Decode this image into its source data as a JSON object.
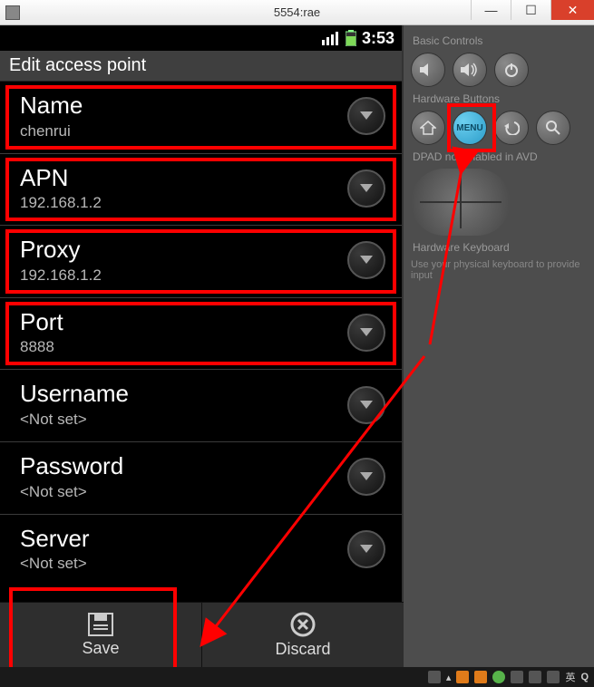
{
  "window": {
    "title": "5554:rae"
  },
  "statusbar": {
    "time": "3:53"
  },
  "screen": {
    "header": "Edit access point",
    "items": [
      {
        "title": "Name",
        "value": "chenrui",
        "highlighted": true
      },
      {
        "title": "APN",
        "value": "192.168.1.2",
        "highlighted": true
      },
      {
        "title": "Proxy",
        "value": "192.168.1.2",
        "highlighted": true
      },
      {
        "title": "Port",
        "value": "8888",
        "highlighted": true
      },
      {
        "title": "Username",
        "value": "<Not set>",
        "highlighted": false
      },
      {
        "title": "Password",
        "value": "<Not set>",
        "highlighted": false
      },
      {
        "title": "Server",
        "value": "<Not set>",
        "highlighted": false
      }
    ],
    "actions": {
      "save": "Save",
      "discard": "Discard"
    }
  },
  "side": {
    "section_basic": "Basic Controls",
    "section_hardware": "Hardware Buttons",
    "dpad_label": "DPAD not enabled in AVD",
    "keyboard_label": "Hardware Keyboard",
    "keyboard_hint": "Use your physical keyboard to provide input",
    "menu_label": "MENU"
  },
  "taskbar": {
    "ime": "英",
    "extra": "Q"
  }
}
